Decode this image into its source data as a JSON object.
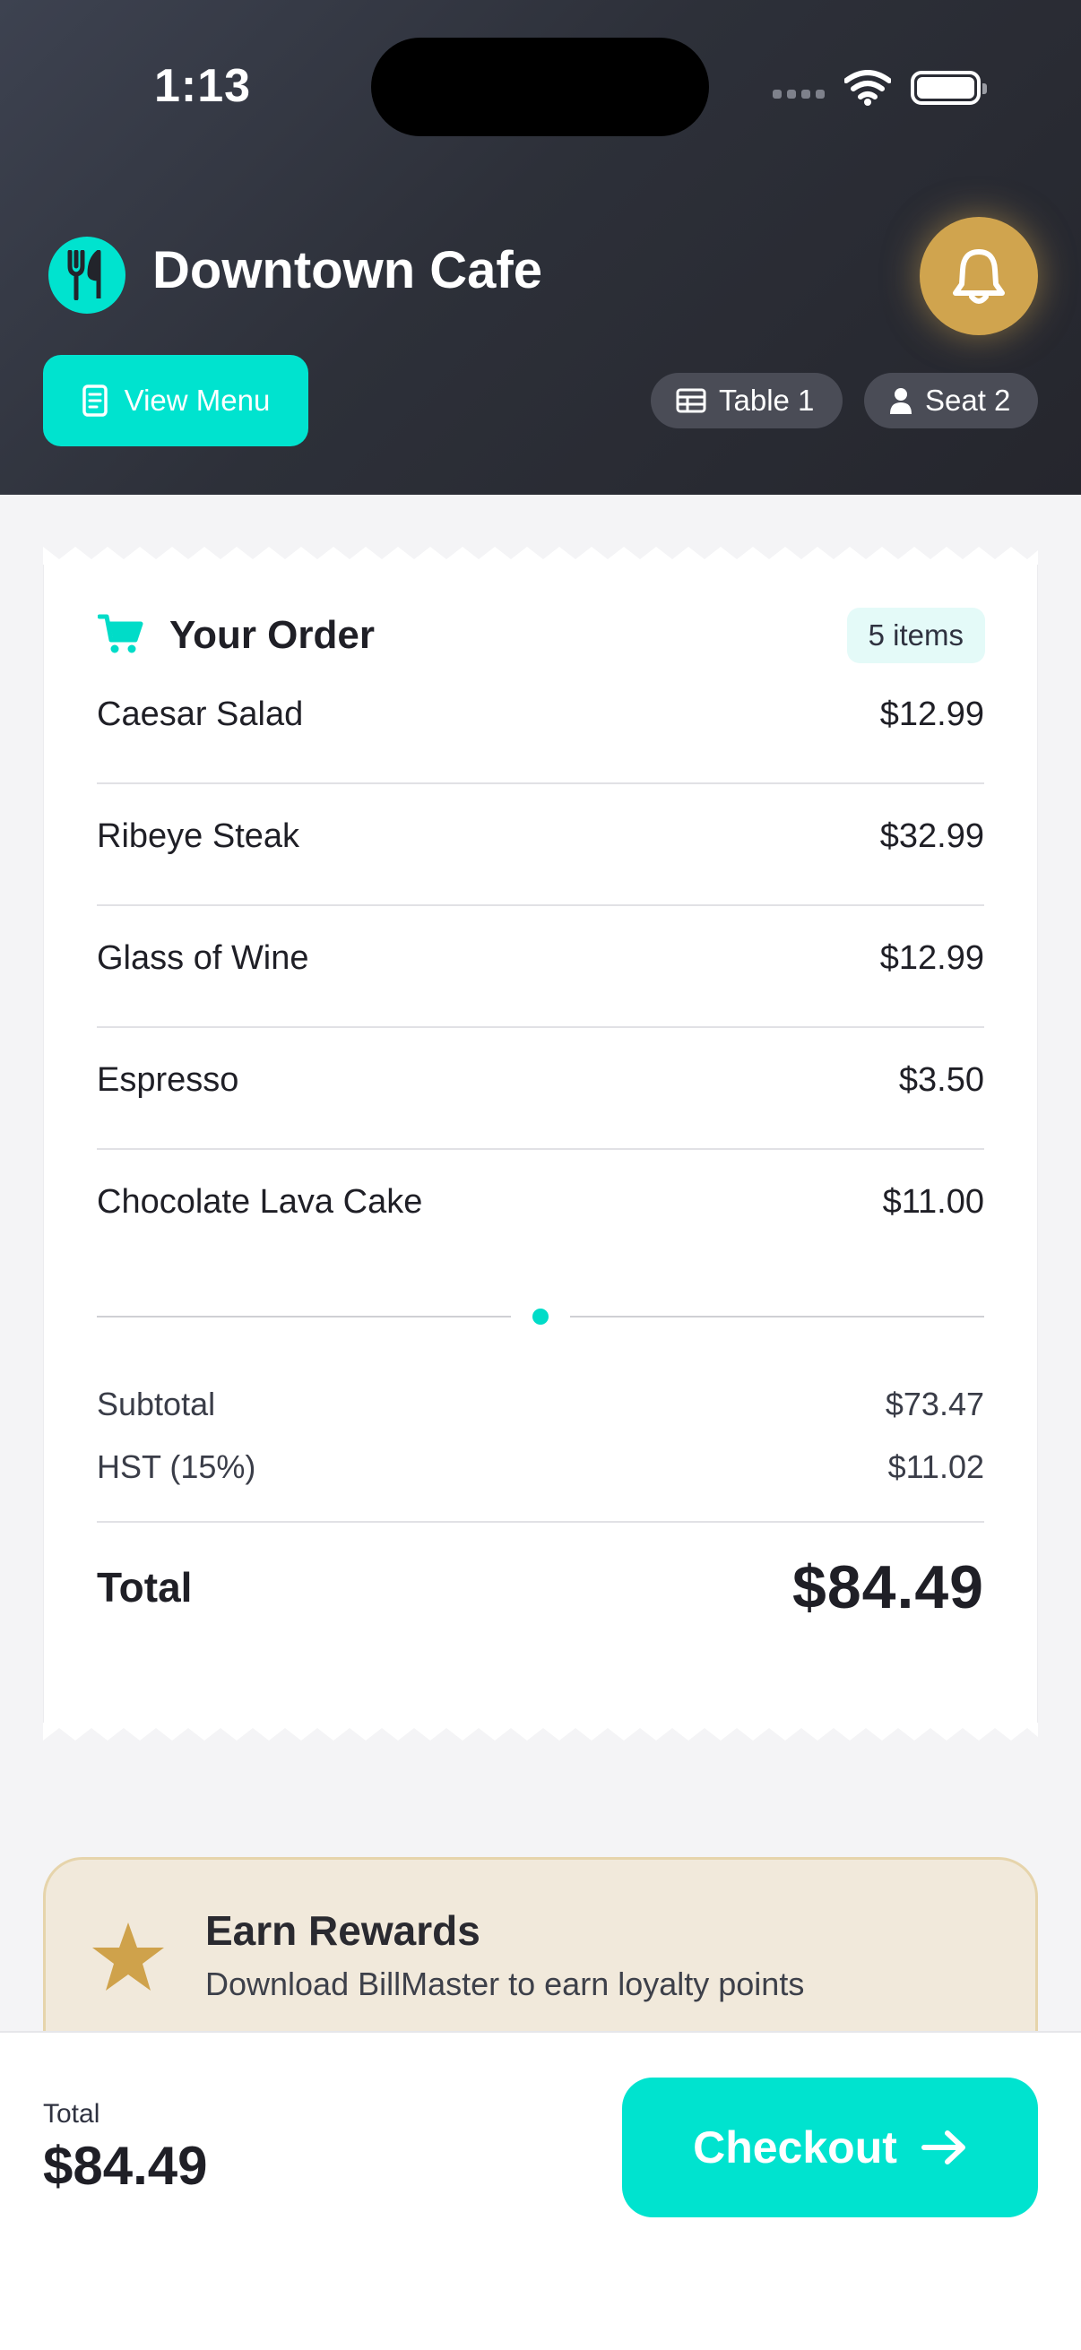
{
  "status_bar": {
    "time": "1:13",
    "icons": [
      "cellular-signal-icon",
      "wifi-icon",
      "battery-icon"
    ]
  },
  "header": {
    "restaurant_name": "Downtown Cafe",
    "logo_icon": "fork-knife-icon",
    "notification_icon": "bell-icon",
    "view_menu_label": "View Menu",
    "table_label": "Table 1",
    "seat_label": "Seat 2"
  },
  "order": {
    "title": "Your Order",
    "item_count": "5 items",
    "items": [
      {
        "name": "Caesar Salad",
        "price": "$12.99"
      },
      {
        "name": "Ribeye Steak",
        "price": "$32.99"
      },
      {
        "name": "Glass of Wine",
        "price": "$12.99"
      },
      {
        "name": "Espresso",
        "price": "$3.50"
      },
      {
        "name": "Chocolate Lava Cake",
        "price": "$11.00"
      }
    ],
    "subtotal_label": "Subtotal",
    "subtotal_value": "$73.47",
    "tax_label": "HST (15%)",
    "tax_value": "$11.02",
    "total_label": "Total",
    "total_value": "$84.49"
  },
  "rewards": {
    "title": "Earn Rewards",
    "subtitle": "Download BillMaster to earn loyalty points"
  },
  "bottom_bar": {
    "total_label": "Total",
    "total_value": "$84.49",
    "checkout_label": "Checkout"
  },
  "colors": {
    "accent": "#00e3cf",
    "gold": "#d0a44e",
    "header_dark": "#2d3039"
  }
}
